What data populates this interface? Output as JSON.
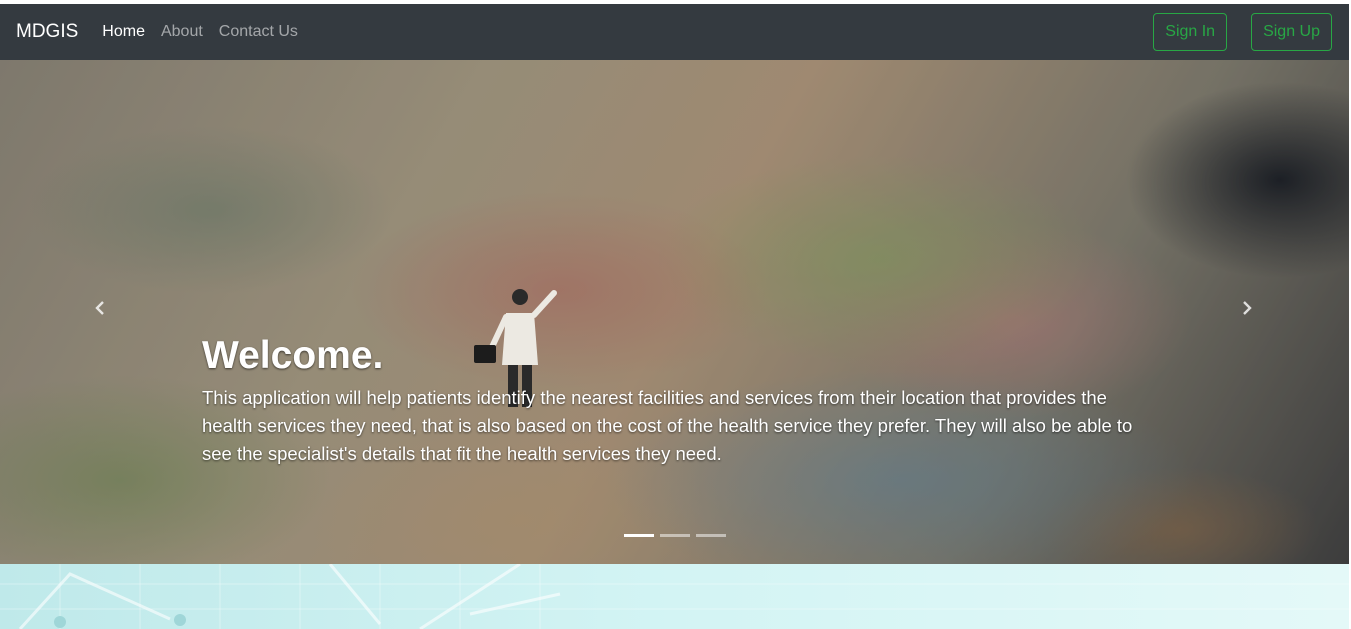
{
  "navbar": {
    "brand": "MDGIS",
    "links": [
      {
        "label": "Home",
        "active": true
      },
      {
        "label": "About",
        "active": false
      },
      {
        "label": "Contact Us",
        "active": false
      }
    ],
    "sign_in_label": "Sign In",
    "sign_up_label": "Sign Up"
  },
  "carousel": {
    "heading": "Welcome.",
    "text": "This application will help patients identify the nearest facilities and services from their location that provides the health services they need, that is also based on the cost of the health service they prefer. They will also be able to see the specialist's details that fit the health services they need.",
    "prev_icon": "chevron-left-icon",
    "next_icon": "chevron-right-icon",
    "active_slide": 1,
    "slide_count": 3
  },
  "colors": {
    "navbar_bg": "#343a40",
    "accent_green": "#28a745",
    "below_section": "#d3f4f4"
  }
}
